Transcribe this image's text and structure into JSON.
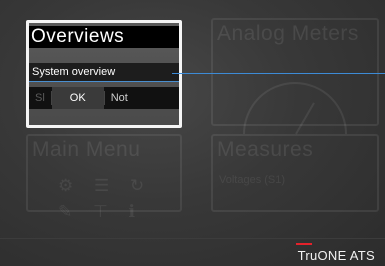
{
  "tiles": {
    "overviews": {
      "title": "Overviews",
      "item": "System overview",
      "buttons": {
        "left_partial": "Sl",
        "ok": "OK",
        "right_partial": "Not"
      }
    },
    "analog_meters": {
      "title": "Analog Meters"
    },
    "main_menu": {
      "title": "Main Menu"
    },
    "measures": {
      "title": "Measures",
      "item": "Voltages (S1)"
    }
  },
  "brand": "TruONE ATS",
  "colors": {
    "accent": "#3d8bd6",
    "brand_mark": "#e4222b",
    "focus": "#f5f5f5"
  }
}
